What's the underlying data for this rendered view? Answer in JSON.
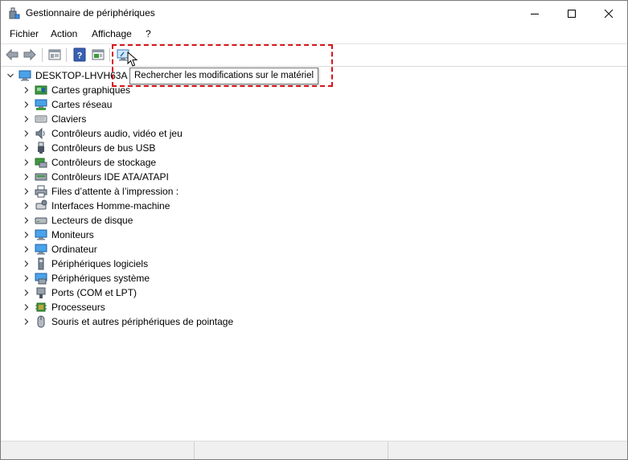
{
  "window": {
    "title": "Gestionnaire de périphériques",
    "controls": {
      "minimize": "minimize-icon",
      "maximize": "maximize-icon",
      "close": "close-icon"
    }
  },
  "menu": [
    "Fichier",
    "Action",
    "Affichage",
    "?"
  ],
  "toolbar": {
    "buttons": [
      "back-arrow-icon",
      "forward-arrow-icon",
      "properties-icon",
      "help-icon",
      "update-driver-icon",
      "scan-hardware-icon"
    ]
  },
  "tooltip": {
    "text": "Rechercher les modifications sur le matériel"
  },
  "highlight_color": "#d9141d",
  "tree": {
    "root": {
      "label": "DESKTOP-LHVH63A",
      "icon": "computer-icon",
      "expanded": true
    },
    "categories": [
      {
        "label": "Cartes graphiques",
        "icon": "display-adapter-icon"
      },
      {
        "label": "Cartes réseau",
        "icon": "network-adapter-icon"
      },
      {
        "label": "Claviers",
        "icon": "keyboard-icon"
      },
      {
        "label": "Contrôleurs audio, vidéo et jeu",
        "icon": "speaker-icon"
      },
      {
        "label": "Contrôleurs de bus USB",
        "icon": "usb-icon"
      },
      {
        "label": "Contrôleurs de stockage",
        "icon": "storage-controller-icon"
      },
      {
        "label": "Contrôleurs IDE ATA/ATAPI",
        "icon": "ide-controller-icon"
      },
      {
        "label": "Files d’attente à l’impression :",
        "icon": "printer-icon"
      },
      {
        "label": "Interfaces Homme-machine",
        "icon": "hid-icon"
      },
      {
        "label": "Lecteurs de disque",
        "icon": "disk-drive-icon"
      },
      {
        "label": "Moniteurs",
        "icon": "monitor-icon"
      },
      {
        "label": "Ordinateur",
        "icon": "computer-icon"
      },
      {
        "label": "Périphériques logiciels",
        "icon": "software-device-icon"
      },
      {
        "label": "Périphériques système",
        "icon": "system-device-icon"
      },
      {
        "label": "Ports (COM et LPT)",
        "icon": "port-icon"
      },
      {
        "label": "Processeurs",
        "icon": "processor-icon"
      },
      {
        "label": "Souris et autres périphériques de pointage",
        "icon": "mouse-icon"
      }
    ]
  }
}
